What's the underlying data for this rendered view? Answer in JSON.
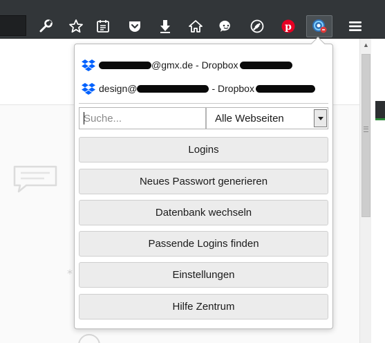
{
  "toolbar": {
    "icons": [
      "wrench-icon",
      "star-icon",
      "reader-icon",
      "pocket-icon",
      "download-icon",
      "home-icon",
      "chat-icon",
      "pen-icon",
      "pinterest-icon",
      "password-manager-icon",
      "menu-icon"
    ]
  },
  "popup": {
    "accounts": [
      {
        "email_visible": "@gmx.de - Dropbox",
        "icon": "dropbox-icon"
      },
      {
        "prefix": "design@",
        "suffix": "- Dropbox",
        "icon": "dropbox-icon"
      }
    ],
    "search": {
      "placeholder": "Suche...",
      "value": ""
    },
    "scope_select": {
      "selected": "Alle Webseiten"
    },
    "buttons": [
      "Logins",
      "Neues Passwort generieren",
      "Datenbank wechseln",
      "Passende Logins finden",
      "Einstellungen",
      "Hilfe Zentrum"
    ]
  },
  "colors": {
    "toolbar_bg": "#323639",
    "pocket_red": "#ee4056",
    "pinterest_red": "#e60023",
    "dropbox_blue": "#0061fe",
    "button_bg": "#ececec"
  }
}
